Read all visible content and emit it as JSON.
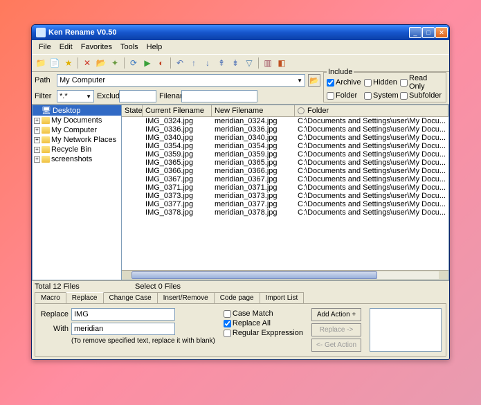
{
  "title": "Ken Rename V0.50",
  "menu": [
    "File",
    "Edit",
    "Favorites",
    "Tools",
    "Help"
  ],
  "path": {
    "label": "Path",
    "value": "My Computer"
  },
  "filter": {
    "label": "Filter",
    "value": "*.*",
    "exclude_label": "Exclude",
    "exclude_value": "",
    "filename_label": "Filename",
    "filename_value": ""
  },
  "include": {
    "legend": "Include",
    "row1": [
      {
        "label": "Archive",
        "checked": true
      },
      {
        "label": "Hidden",
        "checked": false
      },
      {
        "label": "Read Only",
        "checked": false
      }
    ],
    "row2": [
      {
        "label": "Folder",
        "checked": false
      },
      {
        "label": "System",
        "checked": false
      },
      {
        "label": "Subfolder",
        "checked": false
      }
    ]
  },
  "tree": {
    "root": "Desktop",
    "items": [
      "My Documents",
      "My Computer",
      "My Network Places",
      "Recycle Bin",
      "screenshots"
    ]
  },
  "columns": {
    "state": "State",
    "current": "Current Filename",
    "new": "New Filename",
    "folder": "Folder"
  },
  "rows": [
    {
      "cur": "IMG_0324.jpg",
      "new": "meridian_0324.jpg",
      "folder": "C:\\Documents and Settings\\user\\My Docu..."
    },
    {
      "cur": "IMG_0336.jpg",
      "new": "meridian_0336.jpg",
      "folder": "C:\\Documents and Settings\\user\\My Docu..."
    },
    {
      "cur": "IMG_0340.jpg",
      "new": "meridian_0340.jpg",
      "folder": "C:\\Documents and Settings\\user\\My Docu..."
    },
    {
      "cur": "IMG_0354.jpg",
      "new": "meridian_0354.jpg",
      "folder": "C:\\Documents and Settings\\user\\My Docu..."
    },
    {
      "cur": "IMG_0359.jpg",
      "new": "meridian_0359.jpg",
      "folder": "C:\\Documents and Settings\\user\\My Docu..."
    },
    {
      "cur": "IMG_0365.jpg",
      "new": "meridian_0365.jpg",
      "folder": "C:\\Documents and Settings\\user\\My Docu..."
    },
    {
      "cur": "IMG_0366.jpg",
      "new": "meridian_0366.jpg",
      "folder": "C:\\Documents and Settings\\user\\My Docu..."
    },
    {
      "cur": "IMG_0367.jpg",
      "new": "meridian_0367.jpg",
      "folder": "C:\\Documents and Settings\\user\\My Docu..."
    },
    {
      "cur": "IMG_0371.jpg",
      "new": "meridian_0371.jpg",
      "folder": "C:\\Documents and Settings\\user\\My Docu..."
    },
    {
      "cur": "IMG_0373.jpg",
      "new": "meridian_0373.jpg",
      "folder": "C:\\Documents and Settings\\user\\My Docu..."
    },
    {
      "cur": "IMG_0377.jpg",
      "new": "meridian_0377.jpg",
      "folder": "C:\\Documents and Settings\\user\\My Docu..."
    },
    {
      "cur": "IMG_0378.jpg",
      "new": "meridian_0378.jpg",
      "folder": "C:\\Documents and Settings\\user\\My Docu..."
    }
  ],
  "status": {
    "total": "Total 12 Files",
    "select": "Select 0 Files"
  },
  "tabs": [
    "Macro",
    "Replace",
    "Change Case",
    "Insert/Remove",
    "Code page",
    "Import List"
  ],
  "active_tab": 1,
  "replace_panel": {
    "replace_label": "Replace",
    "replace_value": "IMG",
    "with_label": "With",
    "with_value": "meridian",
    "hint": "(To remove specified text, replace it with blank)",
    "case_match": "Case Match",
    "replace_all": "Replace All",
    "regex": "Regular Exppression",
    "add_action": "Add Action +",
    "replace_btn": "Replace ->",
    "get_action": "<- Get Action"
  }
}
